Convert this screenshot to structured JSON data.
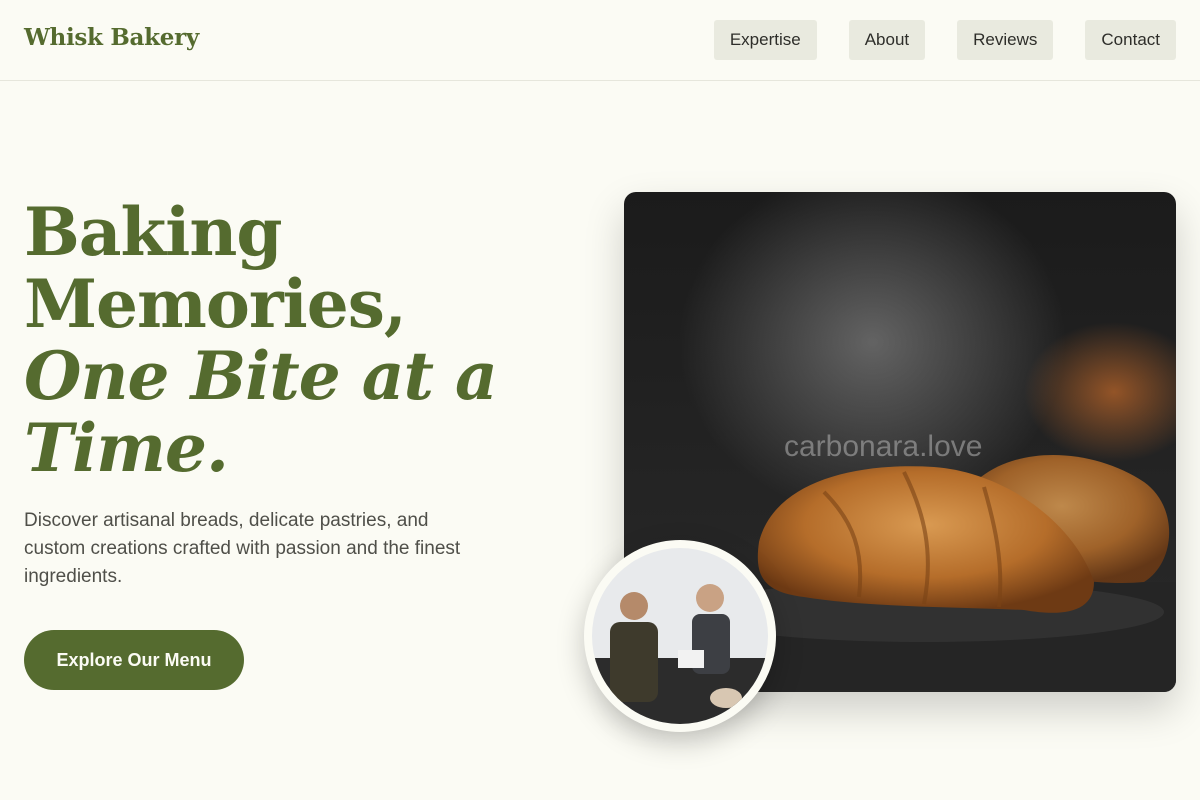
{
  "header": {
    "logo": "Whisk Bakery",
    "nav": [
      {
        "label": "Expertise"
      },
      {
        "label": "About"
      },
      {
        "label": "Reviews"
      },
      {
        "label": "Contact"
      }
    ]
  },
  "hero": {
    "title_line1": "Baking",
    "title_line2": "Memories,",
    "title_line3": "One Bite at a",
    "title_line4": "Time.",
    "description": "Discover artisanal breads, delicate pastries, and custom creations crafted with passion and the finest ingredients.",
    "cta_label": "Explore Our Menu",
    "image_watermark": "carbonara.love"
  },
  "colors": {
    "background": "#fbfbf4",
    "accent": "#556b2f",
    "nav_button_bg": "#e9eadf"
  }
}
